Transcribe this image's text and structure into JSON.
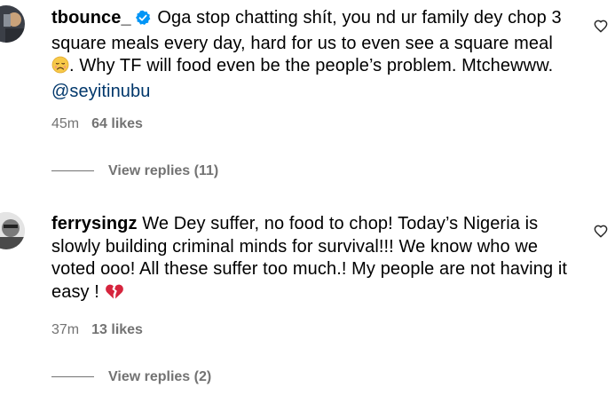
{
  "comments": [
    {
      "username": "tbounce_",
      "verified": true,
      "text": "Oga stop chatting shít, you nd ur family dey chop 3 square meals every day, hard for us to even see a square meal",
      "emoji": "disappointed-face",
      "text_after_emoji": ". Why TF will food even be the people’s problem. Mtchewww.",
      "mention": "@seyitinubu",
      "time": "45m",
      "likes": "64 likes",
      "replies": "View replies (11)"
    },
    {
      "username": "ferrysingz",
      "verified": false,
      "text": "We Dey suffer, no food to chop! Today’s Nigeria is slowly building criminal minds for survival!!! We know who we voted ooo! All these suffer too much.! My people are not having it easy !",
      "emoji": "broken-heart",
      "time": "37m",
      "likes": "13 likes",
      "replies": "View replies (2)"
    }
  ],
  "colors": {
    "text": "#000000",
    "secondary": "#737373",
    "mention": "#00376b",
    "verified": "#0095f6",
    "broken_heart": "#d6243d"
  }
}
